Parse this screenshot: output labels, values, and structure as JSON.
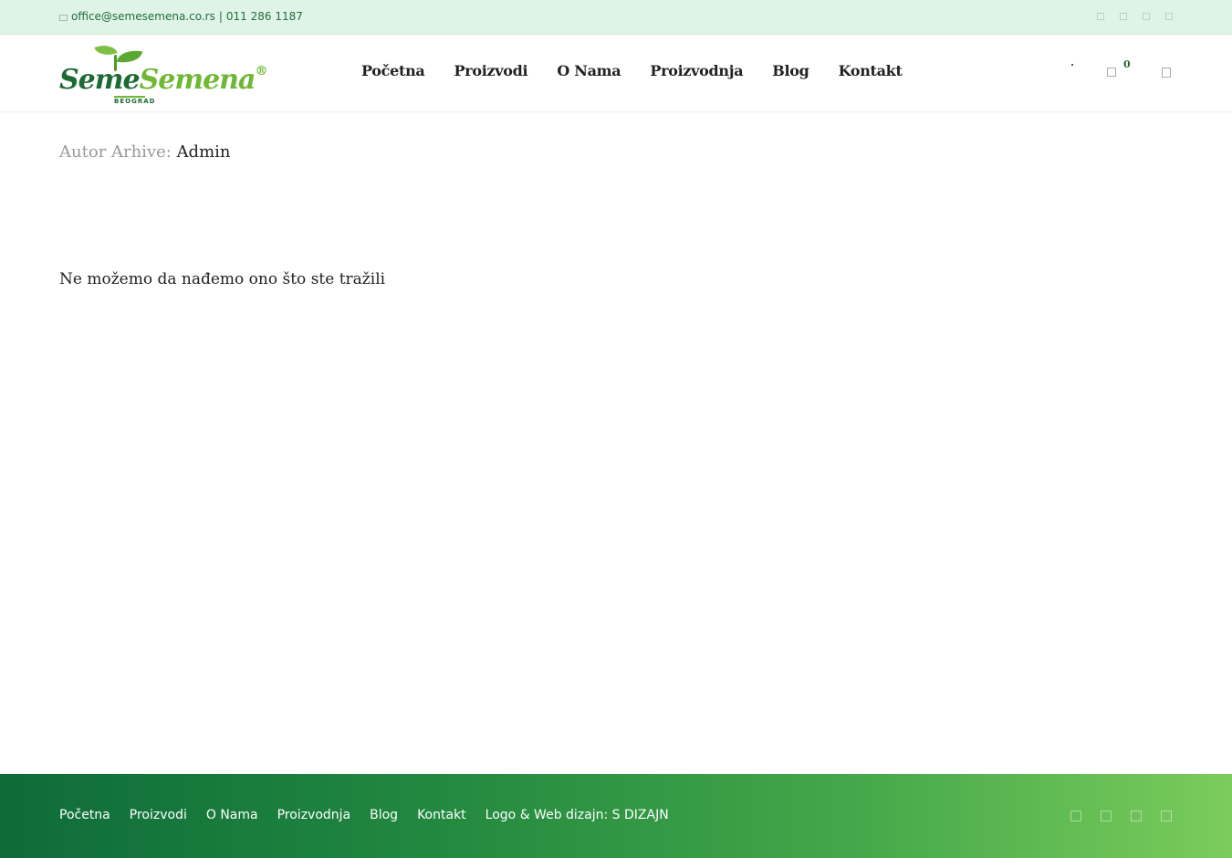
{
  "topbar": {
    "email": "office@semesemena.co.rs",
    "separator": "|",
    "phone": "011 286 1187",
    "social_icons": [
      "facebook-icon",
      "twitter-icon",
      "instagram-icon",
      "youtube-icon"
    ]
  },
  "header": {
    "logo": {
      "word1": "Seme",
      "word2": "Semena",
      "reg": "®",
      "sub": "BEOGRAD"
    },
    "nav": [
      {
        "label": "Početna"
      },
      {
        "label": "Proizvodi"
      },
      {
        "label": "O Nama"
      },
      {
        "label": "Proizvodnja"
      },
      {
        "label": "Blog"
      },
      {
        "label": "Kontakt"
      }
    ],
    "cart_count": "0"
  },
  "main": {
    "archive_prefix": "Autor Arhive:",
    "archive_name": "Admin",
    "not_found": "Ne možemo da nađemo ono što ste tražili"
  },
  "footer": {
    "nav": [
      {
        "label": "Početna"
      },
      {
        "label": "Proizvodi"
      },
      {
        "label": "O Nama"
      },
      {
        "label": "Proizvodnja"
      },
      {
        "label": "Blog"
      },
      {
        "label": "Kontakt"
      }
    ],
    "credit": "Logo & Web dizajn: S DIZAJN",
    "social_icons": [
      "facebook-icon",
      "twitter-icon",
      "instagram-icon",
      "youtube-icon"
    ]
  },
  "colors": {
    "brand_dark": "#1d6b34",
    "brand_light": "#6fb834",
    "topbar_bg": "#dff3e7"
  }
}
